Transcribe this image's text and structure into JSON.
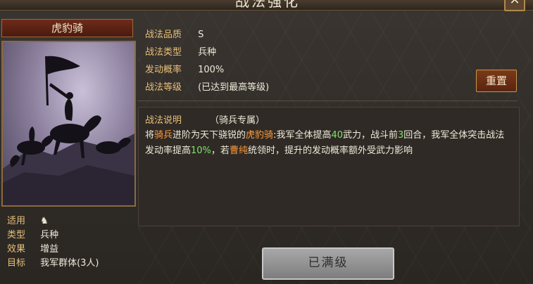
{
  "dialog": {
    "title": "战法强化",
    "close_icon": "close-icon",
    "hero_name": "虎豹骑"
  },
  "tactic": {
    "quality_label": "战法品质",
    "quality_value": "S",
    "type_label": "战法类型",
    "type_value": "兵种",
    "chance_label": "发动概率",
    "chance_value": "100%",
    "level_label": "战法等级",
    "level_value": "(已达到最高等级)",
    "reset_label": "重置"
  },
  "description": {
    "title": "战法说明",
    "subtitle": "（骑兵专属）",
    "segments": [
      {
        "text": "将",
        "color": "normal"
      },
      {
        "text": "骑兵",
        "color": "orange"
      },
      {
        "text": "进阶为天下骁锐的",
        "color": "normal"
      },
      {
        "text": "虎豹骑",
        "color": "orange"
      },
      {
        "text": ":我军全体提高",
        "color": "normal"
      },
      {
        "text": "40",
        "color": "green"
      },
      {
        "text": "武力，战斗前",
        "color": "normal"
      },
      {
        "text": "3",
        "color": "green"
      },
      {
        "text": "回合，我军全体突击战法发动率提高",
        "color": "normal"
      },
      {
        "text": "10%",
        "color": "green"
      },
      {
        "text": "，若",
        "color": "normal"
      },
      {
        "text": "曹纯",
        "color": "orange"
      },
      {
        "text": "统领时，提升的发动概率额外受武力影响",
        "color": "normal"
      }
    ]
  },
  "stats": {
    "apply_label": "适用",
    "apply_icon": "horse-icon",
    "type_label": "类型",
    "type_value": "兵种",
    "effect_label": "效果",
    "effect_value": "增益",
    "target_label": "目标",
    "target_value": "我军群体(3人)"
  },
  "footer": {
    "maxed_label": "已满级"
  },
  "colors": {
    "highlight_orange": "#ff9a3c",
    "highlight_green": "#7fe36a",
    "label_gold": "#e8c07a"
  }
}
